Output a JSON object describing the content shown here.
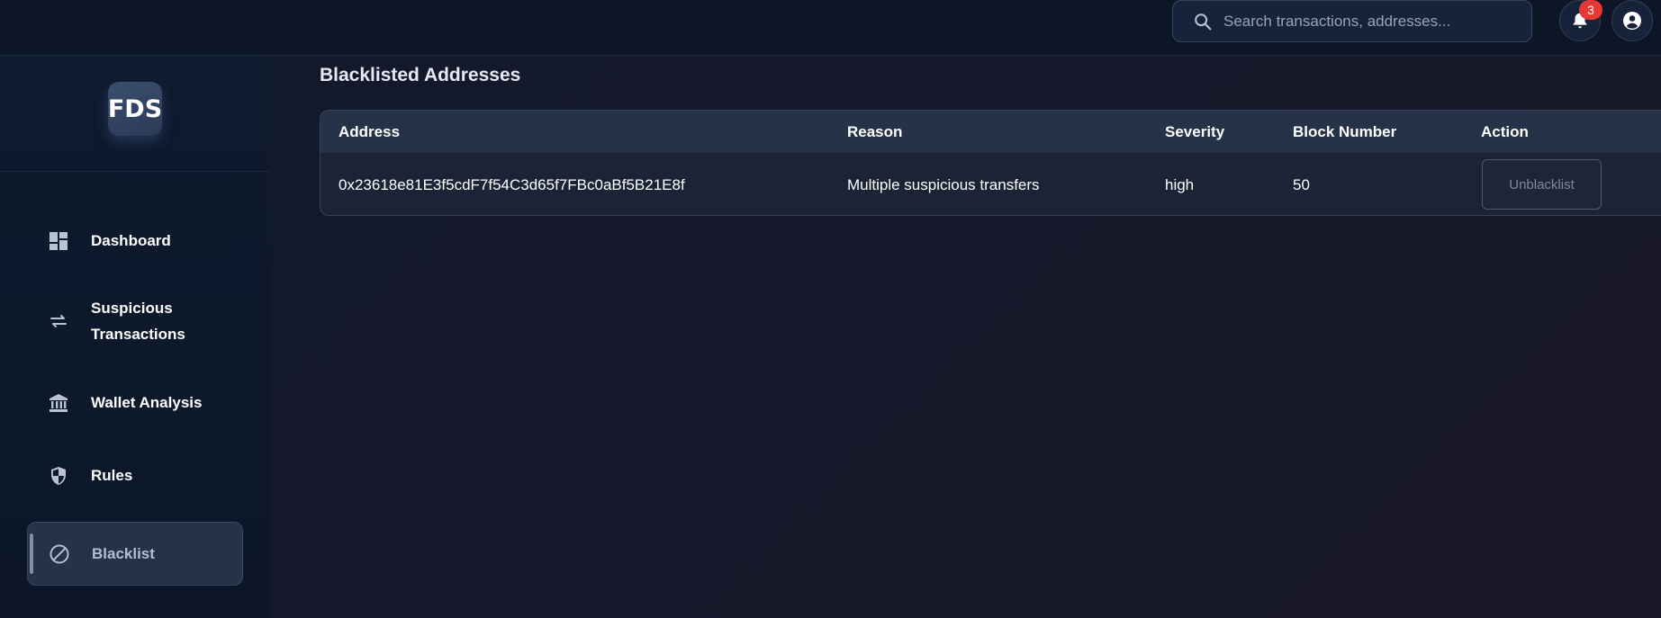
{
  "header": {
    "search_placeholder": "Search transactions, addresses...",
    "notification_count": "3",
    "icons": [
      "search-icon",
      "bell-icon",
      "account-icon"
    ]
  },
  "sidebar": {
    "logo_text": "FDS",
    "items": [
      {
        "label": "Dashboard",
        "icon": "dashboard-icon",
        "active": false
      },
      {
        "label": "Suspicious\nTransactions",
        "icon": "swap-arrows-icon",
        "active": false
      },
      {
        "label": "Wallet Analysis",
        "icon": "bank-icon",
        "active": false
      },
      {
        "label": "Rules",
        "icon": "shield-icon",
        "active": false
      },
      {
        "label": "Blacklist",
        "icon": "block-icon",
        "active": true
      }
    ]
  },
  "main": {
    "title": "Blacklisted Addresses",
    "table": {
      "columns": [
        "Address",
        "Reason",
        "Severity",
        "Block Number",
        "Action"
      ],
      "rows": [
        {
          "address": "0x23618e81E3f5cdF7f54C3d65f7FBc0aBf5B21E8f",
          "reason": "Multiple suspicious transfers",
          "severity": "high",
          "block_number": "50",
          "action_label": "Unblacklist"
        }
      ]
    }
  },
  "colors": {
    "accent": "#7f8ea6",
    "badge": "#e53935"
  }
}
